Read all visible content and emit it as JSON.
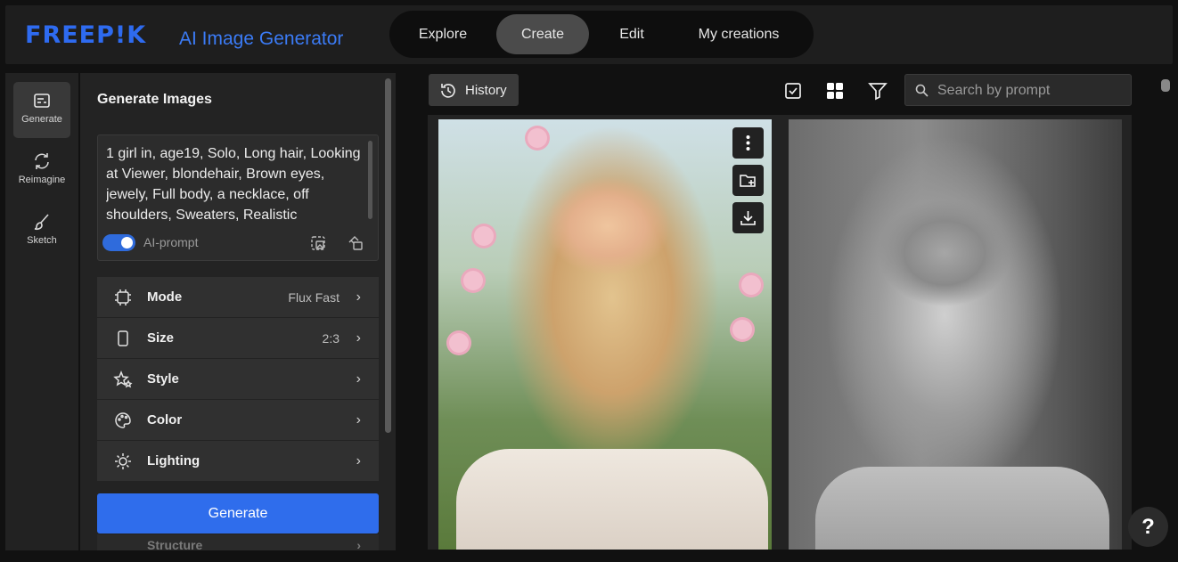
{
  "header": {
    "logo": "FREEP!K",
    "subtitle": "AI Image Generator",
    "nav": [
      {
        "label": "Explore"
      },
      {
        "label": "Create"
      },
      {
        "label": "Edit"
      },
      {
        "label": "My creations"
      }
    ],
    "active_nav": "Create"
  },
  "rail": {
    "items": [
      {
        "label": "Generate",
        "icon": "generate-icon"
      },
      {
        "label": "Reimagine",
        "icon": "reimagine-icon"
      },
      {
        "label": "Sketch",
        "icon": "brush-icon"
      }
    ],
    "active": "Generate"
  },
  "panel": {
    "title": "Generate Images",
    "prompt": "1 girl in, age19, Solo, Long hair, Looking at Viewer, blondehair, Brown eyes, jewely, Full body, a necklace, off shoulders, Sweaters, Realistic",
    "ai_prompt_label": "AI-prompt",
    "ai_prompt_enabled": true,
    "settings": [
      {
        "label": "Mode",
        "value": "Flux Fast",
        "icon": "chip-icon"
      },
      {
        "label": "Size",
        "value": "2:3",
        "icon": "phone-size-icon"
      },
      {
        "label": "Style",
        "value": "",
        "icon": "sparkle-star-icon"
      },
      {
        "label": "Color",
        "value": "",
        "icon": "palette-icon"
      },
      {
        "label": "Lighting",
        "value": "",
        "icon": "sun-icon"
      }
    ],
    "peek_label": "Structure",
    "generate_label": "Generate"
  },
  "main": {
    "history_label": "History",
    "search_placeholder": "Search by prompt"
  },
  "help_label": "?",
  "colors": {
    "accent": "#2f6dec",
    "logo_blue": "#2e6bf0",
    "background": "#111111",
    "panel": "#232323"
  }
}
